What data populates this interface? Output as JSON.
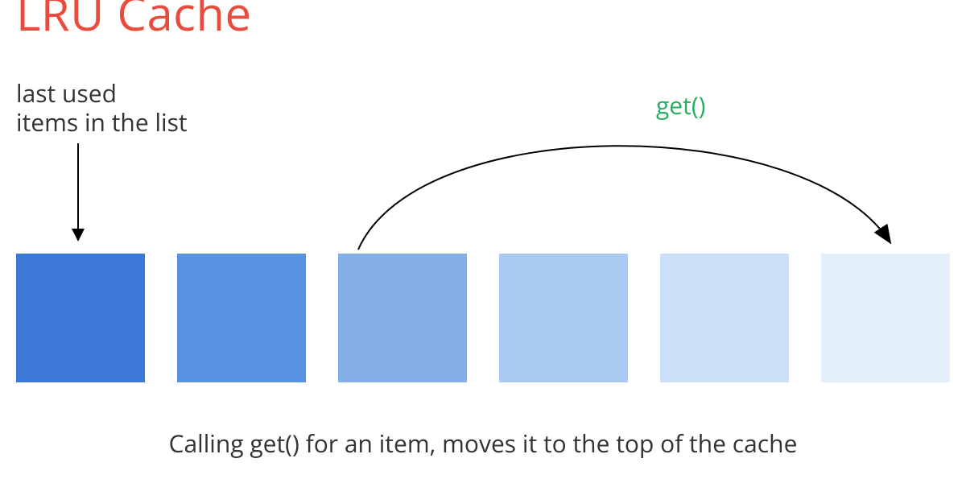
{
  "title": "LRU Cache",
  "labels": {
    "last_used": "last used\nitems in the list",
    "get_call": "get()"
  },
  "caption": "Calling get() for an item, moves it to the top of the cache",
  "boxes": [
    {
      "color": "#3b78d8"
    },
    {
      "color": "#5a92e2"
    },
    {
      "color": "#84afe8"
    },
    {
      "color": "#a9c9f0"
    },
    {
      "color": "#cbdff7"
    },
    {
      "color": "#e3eefb"
    }
  ]
}
